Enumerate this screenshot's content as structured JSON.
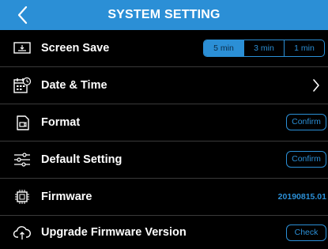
{
  "header": {
    "title": "SYSTEM SETTING"
  },
  "rows": {
    "screen_save": {
      "label": "Screen Save",
      "options": [
        "5 min",
        "3 min",
        "1 min"
      ],
      "selected": "5 min"
    },
    "date_time": {
      "label": "Date & Time"
    },
    "format": {
      "label": "Format",
      "button": "Confirm"
    },
    "default_setting": {
      "label": "Default Setting",
      "button": "Confirm"
    },
    "firmware": {
      "label": "Firmware",
      "value": "20190815.01"
    },
    "upgrade": {
      "label": "Upgrade Firmware Version",
      "button": "Check"
    }
  },
  "colors": {
    "accent": "#2b8fd6",
    "background": "#000000",
    "divider": "#3a3a3a"
  }
}
